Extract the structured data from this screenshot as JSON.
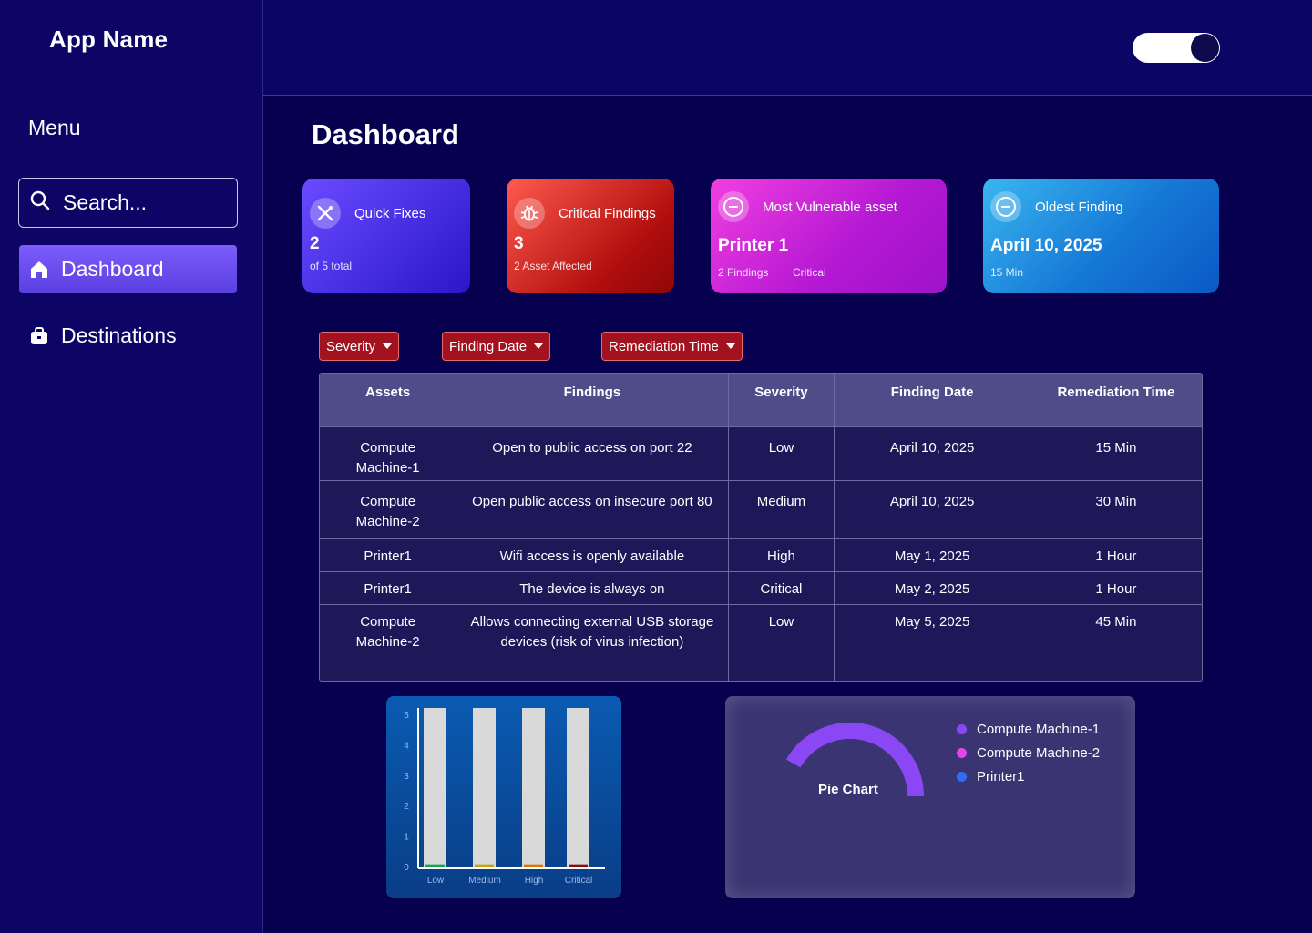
{
  "sidebar": {
    "app_name": "App Name",
    "menu_label": "Menu",
    "search_placeholder": "Search...",
    "items": [
      {
        "label": "Dashboard",
        "icon": "home-icon",
        "active": true
      },
      {
        "label": "Destinations",
        "icon": "briefcase-icon",
        "active": false
      }
    ]
  },
  "header": {
    "theme_toggle_on": true
  },
  "main": {
    "title": "Dashboard",
    "cards": [
      {
        "label": "Quick Fixes",
        "value": "2",
        "sub": "of 5 total",
        "icon": "tools-icon"
      },
      {
        "label": "Critical Findings",
        "value": "3",
        "sub": "2 Asset Affected",
        "icon": "bug-icon"
      },
      {
        "label": "Most Vulnerable asset",
        "value": "Printer 1",
        "sub": "2 Findings",
        "sub2": "Critical",
        "icon": "minus-circle-icon"
      },
      {
        "label": "Oldest Finding",
        "value": "April 10, 2025",
        "sub": "15 Min",
        "icon": "minus-circle-icon"
      }
    ],
    "filters": [
      {
        "label": "Severity"
      },
      {
        "label": "Finding Date"
      },
      {
        "label": "Remediation Time"
      }
    ],
    "table": {
      "headers": [
        "Assets",
        "Findings",
        "Severity",
        "Finding Date",
        "Remediation Time"
      ],
      "rows": [
        [
          "Compute Machine-1",
          "Open to public access on port 22",
          "Low",
          "April 10, 2025",
          "15 Min"
        ],
        [
          "Compute Machine-2",
          "Open public access on insecure port 80",
          "Medium",
          "April 10, 2025",
          "30 Min"
        ],
        [
          "Printer1",
          "Wifi access is openly available",
          "High",
          "May 1, 2025",
          "1 Hour"
        ],
        [
          "Printer1",
          "The device is always on",
          "Critical",
          "May 2, 2025",
          "1 Hour"
        ],
        [
          "Compute Machine-2",
          "Allows connecting external USB storage devices (risk of virus infection)",
          "Low",
          "May 5, 2025",
          "45 Min"
        ]
      ]
    }
  },
  "chart_data": [
    {
      "type": "bar",
      "categories": [
        "Low",
        "Medium",
        "High",
        "Critical"
      ],
      "values": [
        0.1,
        0.1,
        0.1,
        0.1
      ],
      "ylim": [
        0,
        5
      ],
      "yticks": [
        "0",
        "1",
        "2",
        "3",
        "4",
        "5"
      ],
      "colors": {
        "Low": "#16a34a",
        "Medium": "#c9a10a",
        "High": "#d97706",
        "Critical": "#8b0a0a",
        "track": "#d9d9d9"
      }
    },
    {
      "type": "pie",
      "title": "Pie Chart",
      "labels": [
        "Compute Machine-1",
        "Compute Machine-2",
        "Printer1"
      ],
      "colors": [
        "#8a48f5",
        "#e245e8",
        "#2f6df5"
      ]
    }
  ]
}
